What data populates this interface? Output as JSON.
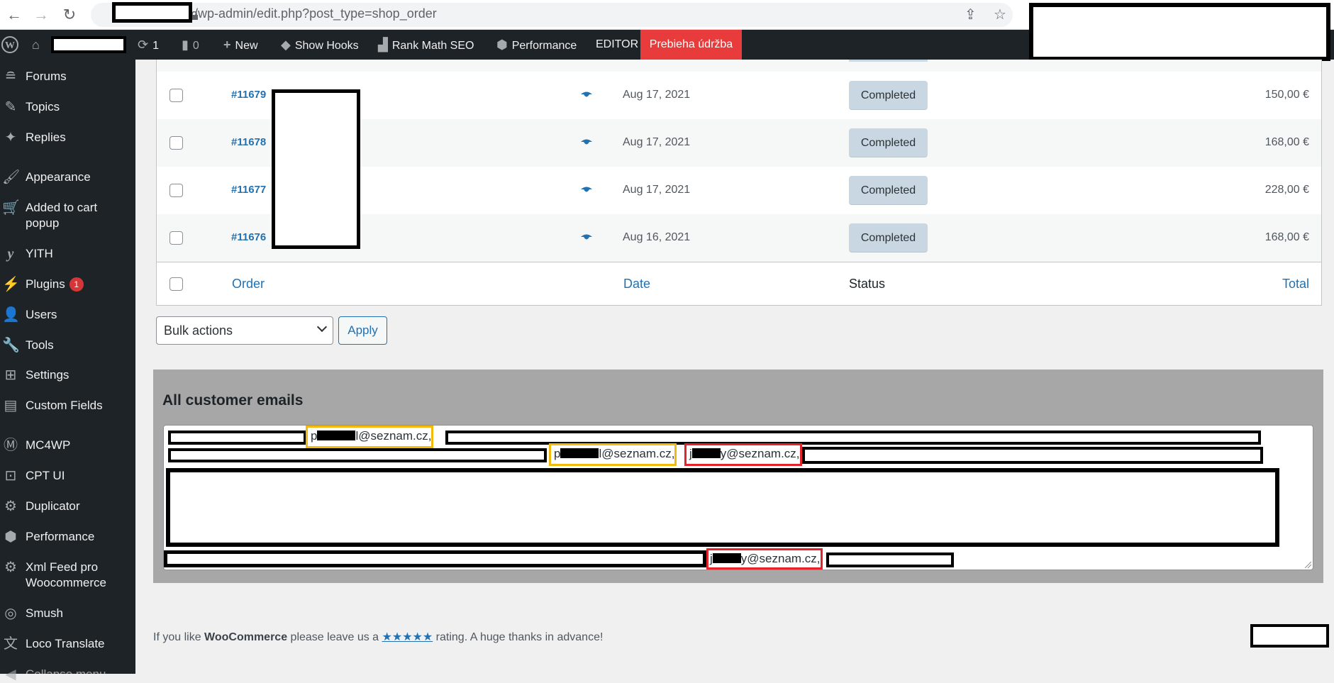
{
  "browser": {
    "url_path": "/wp-admin/edit.php?post_type=shop_order",
    "icons": [
      "back-icon",
      "forward-icon",
      "reload-icon",
      "lock-icon",
      "share-icon",
      "bookmark-star-icon"
    ]
  },
  "adminbar": {
    "updates_count": "1",
    "comments_count": "0",
    "new_label": "New",
    "show_hooks_label": "Show Hooks",
    "rank_math_label": "Rank Math SEO",
    "performance_label": "Performance",
    "editor_label": "EDITOR",
    "maintenance_label": "Prebieha údržba",
    "maintenance_color": "#e83b3b"
  },
  "sidebar": {
    "items": [
      {
        "label": "Forums",
        "icon": "forums-icon"
      },
      {
        "label": "Topics",
        "icon": "topics-icon"
      },
      {
        "label": "Replies",
        "icon": "replies-icon"
      },
      {
        "label": "Appearance",
        "icon": "paintbrush-icon"
      },
      {
        "label": "Added to cart popup",
        "icon": "cart-icon"
      },
      {
        "label": "YITH",
        "icon": "yith-icon"
      },
      {
        "label": "Plugins",
        "icon": "plugin-icon",
        "badge": "1"
      },
      {
        "label": "Users",
        "icon": "user-icon"
      },
      {
        "label": "Tools",
        "icon": "wrench-icon"
      },
      {
        "label": "Settings",
        "icon": "settings-icon"
      },
      {
        "label": "Custom Fields",
        "icon": "custom-fields-icon"
      },
      {
        "label": "MC4WP",
        "icon": "mc4wp-icon"
      },
      {
        "label": "CPT UI",
        "icon": "cpt-ui-icon"
      },
      {
        "label": "Duplicator",
        "icon": "duplicator-icon"
      },
      {
        "label": "Performance",
        "icon": "performance-icon"
      },
      {
        "label": "Xml Feed pro Woocommerce",
        "icon": "gear-icon"
      },
      {
        "label": "Smush",
        "icon": "smush-icon"
      },
      {
        "label": "Loco Translate",
        "icon": "translate-icon"
      },
      {
        "label": "Collapse menu",
        "icon": "collapse-icon"
      }
    ]
  },
  "orders": {
    "rows": [
      {
        "order": "#11679",
        "date": "Aug 17, 2021",
        "status": "Completed",
        "total": "150,00 €"
      },
      {
        "order": "#11678",
        "date": "Aug 17, 2021",
        "status": "Completed",
        "total": "168,00 €"
      },
      {
        "order": "#11677",
        "date": "Aug 17, 2021",
        "status": "Completed",
        "total": "228,00 €"
      },
      {
        "order": "#11676",
        "date": "Aug 16, 2021",
        "status": "Completed",
        "total": "168,00 €"
      }
    ],
    "columns": {
      "order": "Order",
      "date": "Date",
      "status": "Status",
      "total": "Total"
    },
    "status_color": "#c8d7e1"
  },
  "bulk": {
    "selected": "Bulk actions",
    "apply_label": "Apply"
  },
  "emails": {
    "title": "All customer emails",
    "highlighted": [
      {
        "prefix": "p",
        "suffix": "l@seznam.cz,",
        "color": "#f2b90f"
      },
      {
        "prefix": "p",
        "suffix": "l@seznam.cz,",
        "color": "#f2b90f"
      },
      {
        "prefix": "j",
        "suffix": "y@seznam.cz,",
        "color": "#e3242b"
      },
      {
        "prefix": "j",
        "suffix": "y@seznam.cz,",
        "color": "#e3242b"
      }
    ]
  },
  "footer": {
    "prefix": "If you like ",
    "brand": "WooCommerce",
    "middle": " please leave us a ",
    "stars": "★★★★★",
    "suffix": " rating. A huge thanks in advance!"
  }
}
